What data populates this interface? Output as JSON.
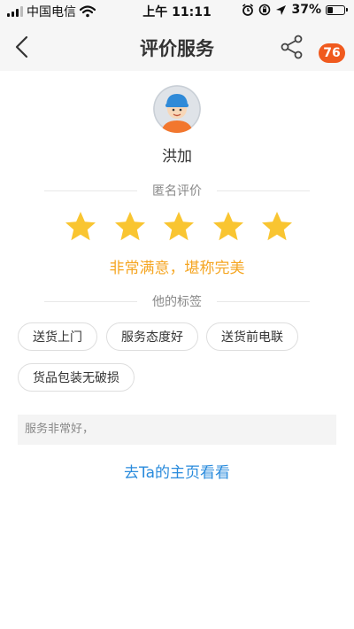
{
  "status_bar": {
    "carrier": "中国电信",
    "time": "上午 11:11",
    "battery_percent": "37%",
    "battery_level": 0.37
  },
  "navbar": {
    "title": "评价服务",
    "badge_count": "76",
    "icons": [
      "back-arrow-icon",
      "share-icon",
      "more-icon"
    ]
  },
  "profile": {
    "name": "洪加"
  },
  "rating": {
    "section_title": "匿名评价",
    "stars": 5,
    "max_stars": 5,
    "star_color": "#f9c531",
    "summary": "非常满意，堪称完美"
  },
  "tags_section": {
    "title": "他的标签",
    "tags": [
      "送货上门",
      "服务态度好",
      "送货前电联",
      "货品包装无破损"
    ]
  },
  "comment": {
    "text": "服务非常好，"
  },
  "link": {
    "label": "去Ta的主页看看"
  },
  "colors": {
    "accent_orange": "#f5a623",
    "badge": "#f05a1e",
    "link_blue": "#2a8bdc"
  }
}
